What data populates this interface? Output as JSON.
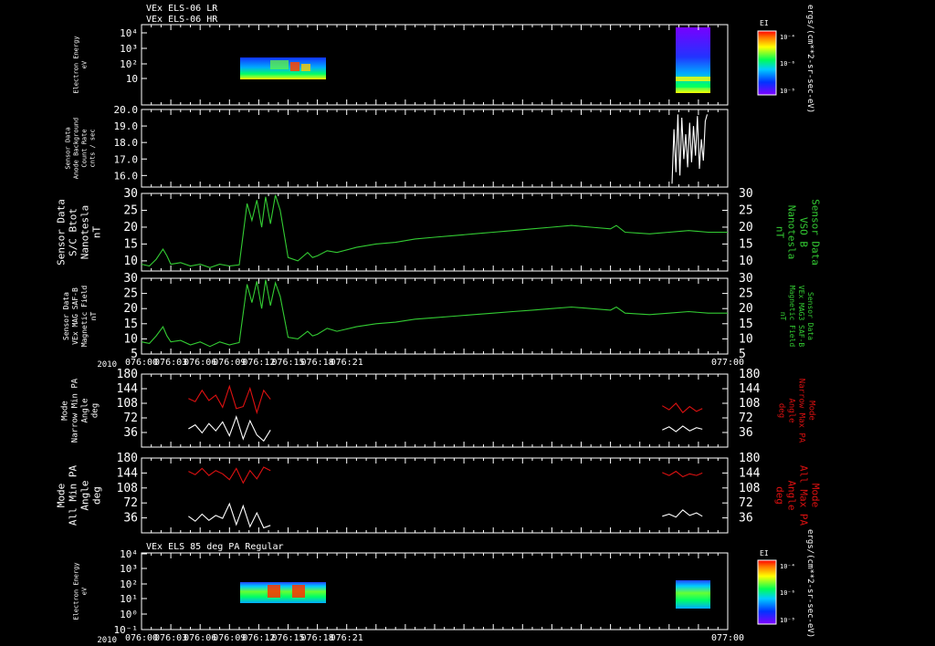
{
  "header": {
    "title_lr": "VEx ELS-06 LR",
    "title_hr": "VEx ELS-06 HR",
    "bottom_title": "VEx ELS 85 deg PA Regular",
    "year": "2010",
    "colorbar_unit": "ergs/(cm**2-sr-sec-eV)",
    "colorbar_label": "EI"
  },
  "colors": {
    "background": "#000000",
    "axis": "#ffffff",
    "mag": "#33cc33",
    "pa_max": "#dd1111",
    "pa_min": "#ffffff"
  },
  "chart_data": [
    {
      "type": "heatmap",
      "panel": "electron-energy-top",
      "ylabel": [
        "Electron Energy",
        "eV"
      ],
      "y_scale": "log",
      "yticks": [
        "10",
        "10²",
        "10³",
        "10⁴"
      ],
      "x_minutes": [
        0,
        60
      ],
      "xticks": [
        "076:00",
        "076:03",
        "076:06",
        "076:09",
        "076:12",
        "076:15",
        "076:18",
        "076:21",
        "077:00"
      ],
      "data_blocks": [
        {
          "t_start": 4.8,
          "t_end": 12.9,
          "e_min": 8,
          "e_max": 200
        },
        {
          "t_start": 53.5,
          "t_end": 57.5,
          "e_min": 4,
          "e_max": 15000
        }
      ],
      "colorbar": {
        "label": "EI",
        "ticks": [
          "10⁻⁴",
          "10⁻⁶",
          "10⁻⁸"
        ]
      }
    },
    {
      "type": "line",
      "panel": "anode-background",
      "ylabel": [
        "Sensor Data",
        "Anode Background",
        "Count Rate",
        "cnts / sec"
      ],
      "ylim": [
        15.3,
        20
      ],
      "yticks": [
        "16.0",
        "17.0",
        "18.0",
        "19.0",
        "20.0"
      ],
      "series": [
        {
          "color": "white",
          "x": [
            54.3,
            54.5,
            54.7,
            54.9,
            55.1,
            55.3,
            55.5,
            55.7,
            55.9,
            56.1,
            56.3,
            56.5,
            56.7,
            56.9,
            57.1,
            57.3,
            57.5,
            57.7,
            57.9
          ],
          "y": [
            15.5,
            18.8,
            16.2,
            19.7,
            16.0,
            19.5,
            17.0,
            18.5,
            16.5,
            19.2,
            16.8,
            19.0,
            17.2,
            19.6,
            16.4,
            18.2,
            16.9,
            19.3,
            19.7
          ]
        }
      ]
    },
    {
      "type": "line",
      "panel": "bmag-sc",
      "ylabel": [
        "Sensor Data",
        "S/C Btot",
        "Nanotesla",
        "nT"
      ],
      "ylabel_right": [
        "Sensor Data",
        "VSO B",
        "Nanotesla",
        "nT"
      ],
      "ylim": [
        7,
        30
      ],
      "yticks": [
        "10",
        "15",
        "20",
        "25",
        "30"
      ],
      "series": [
        {
          "color": "green",
          "x": [
            0,
            0.8,
            1.5,
            2.2,
            2.6,
            3.0,
            4.0,
            5.0,
            6.0,
            7.0,
            8.0,
            9.0,
            10.0,
            10.8,
            11.3,
            11.8,
            12.3,
            12.7,
            13.2,
            13.7,
            14.2,
            15.0,
            16.0,
            17.0,
            17.5,
            18.0,
            19.0,
            20.0,
            22.0,
            24.0,
            26.0,
            28.0,
            30.0,
            32.0,
            34.0,
            36.0,
            38.0,
            40.0,
            42.0,
            44.0,
            46.0,
            48.0,
            48.6,
            49.5,
            52.0,
            54.0,
            56.0,
            58.0,
            60.0
          ],
          "y": [
            9.0,
            8.5,
            10.5,
            13.5,
            11.5,
            9.0,
            9.5,
            8.5,
            9.0,
            8.0,
            9.0,
            8.5,
            8.8,
            27.0,
            22.0,
            28.0,
            20.0,
            29.0,
            21.0,
            29.5,
            25.0,
            11.0,
            10.0,
            12.5,
            11.0,
            11.5,
            13.0,
            12.5,
            14.0,
            15.0,
            15.5,
            16.5,
            17.0,
            17.5,
            18.0,
            18.5,
            19.0,
            19.5,
            20.0,
            20.5,
            20.0,
            19.5,
            20.5,
            18.5,
            18.0,
            18.5,
            19.0,
            18.5,
            18.5
          ]
        }
      ]
    },
    {
      "type": "line",
      "panel": "bmag-saf",
      "ylabel": [
        "Sensor Data",
        "VEx MAG SAF-B",
        "Magnetic Field",
        "nT"
      ],
      "ylabel_right": [
        "Sensor Data",
        "VEx MAG3 SAF-B",
        "Magnetic Field",
        "nT"
      ],
      "ylim": [
        5,
        30
      ],
      "yticks": [
        "5",
        "10",
        "15",
        "20",
        "25",
        "30"
      ],
      "series": [
        {
          "color": "green",
          "x": [
            0,
            0.8,
            1.5,
            2.2,
            2.6,
            3.0,
            4.0,
            5.0,
            6.0,
            7.0,
            8.0,
            9.0,
            10.0,
            10.8,
            11.3,
            11.8,
            12.3,
            12.7,
            13.2,
            13.7,
            14.2,
            15.0,
            16.0,
            17.0,
            17.5,
            18.0,
            19.0,
            20.0,
            22.0,
            24.0,
            26.0,
            28.0,
            30.0,
            32.0,
            34.0,
            36.0,
            38.0,
            40.0,
            42.0,
            44.0,
            46.0,
            48.0,
            48.6,
            49.5,
            52.0,
            54.0,
            56.0,
            58.0,
            60.0
          ],
          "y": [
            9.0,
            8.5,
            11.0,
            14.0,
            11.0,
            9.0,
            9.5,
            8.0,
            9.0,
            7.5,
            9.0,
            8.0,
            8.8,
            28.0,
            22.0,
            29.0,
            20.0,
            29.5,
            21.0,
            28.5,
            24.0,
            10.5,
            10.0,
            12.5,
            11.0,
            11.5,
            13.5,
            12.5,
            14.0,
            15.0,
            15.5,
            16.5,
            17.0,
            17.5,
            18.0,
            18.5,
            19.0,
            19.5,
            20.0,
            20.5,
            20.0,
            19.5,
            20.5,
            18.5,
            18.0,
            18.5,
            19.0,
            18.5,
            18.5
          ]
        }
      ]
    },
    {
      "type": "line",
      "panel": "pa-narrow",
      "ylabel": [
        "Mode",
        "Narrow Min PA",
        "Angle",
        "deg"
      ],
      "ylabel_right": [
        "Mode",
        "Narrow Max PA",
        "Angle",
        "deg"
      ],
      "ylim": [
        0,
        180
      ],
      "yticks": [
        "36",
        "72",
        "108",
        "144",
        "180"
      ],
      "series": [
        {
          "color": "red",
          "x": [
            4.8,
            5.5,
            6.2,
            6.9,
            7.6,
            8.3,
            9.0,
            9.7,
            10.4,
            11.1,
            11.8,
            12.5,
            13.2
          ],
          "y": [
            120,
            112,
            140,
            115,
            128,
            98,
            150,
            95,
            100,
            145,
            85,
            140,
            118
          ]
        },
        {
          "color": "white",
          "x": [
            4.8,
            5.5,
            6.2,
            6.9,
            7.6,
            8.3,
            9.0,
            9.7,
            10.4,
            11.1,
            11.8,
            12.5,
            13.2
          ],
          "y": [
            45,
            55,
            35,
            58,
            40,
            62,
            28,
            75,
            20,
            65,
            30,
            15,
            42
          ]
        },
        {
          "color": "red",
          "x": [
            53.3,
            54.0,
            54.7,
            55.4,
            56.1,
            56.8,
            57.4
          ],
          "y": [
            102,
            92,
            108,
            85,
            100,
            88,
            95
          ]
        },
        {
          "color": "white",
          "x": [
            53.3,
            54.0,
            54.7,
            55.4,
            56.1,
            56.8,
            57.4
          ],
          "y": [
            42,
            50,
            38,
            52,
            40,
            48,
            44
          ]
        }
      ]
    },
    {
      "type": "line",
      "panel": "pa-all",
      "ylabel": [
        "Mode",
        "All Min PA",
        "Angle",
        "deg"
      ],
      "ylabel_right": [
        "Mode",
        "All Max PA",
        "Angle",
        "deg"
      ],
      "ylim": [
        0,
        180
      ],
      "yticks": [
        "36",
        "72",
        "108",
        "144",
        "180"
      ],
      "series": [
        {
          "color": "red",
          "x": [
            4.8,
            5.5,
            6.2,
            6.9,
            7.6,
            8.3,
            9.0,
            9.7,
            10.4,
            11.1,
            11.8,
            12.5,
            13.2
          ],
          "y": [
            148,
            140,
            155,
            138,
            150,
            142,
            128,
            155,
            120,
            150,
            130,
            158,
            150
          ]
        },
        {
          "color": "white",
          "x": [
            4.8,
            5.5,
            6.2,
            6.9,
            7.6,
            8.3,
            9.0,
            9.7,
            10.4,
            11.1,
            11.8,
            12.5,
            13.2
          ],
          "y": [
            40,
            28,
            45,
            30,
            42,
            35,
            70,
            20,
            65,
            15,
            48,
            12,
            18
          ]
        },
        {
          "color": "red",
          "x": [
            53.3,
            54.0,
            54.7,
            55.4,
            56.1,
            56.8,
            57.4
          ],
          "y": [
            145,
            138,
            148,
            135,
            142,
            138,
            144
          ]
        },
        {
          "color": "white",
          "x": [
            53.3,
            54.0,
            54.7,
            55.4,
            56.1,
            56.8,
            57.4
          ],
          "y": [
            40,
            45,
            38,
            55,
            42,
            48,
            40
          ]
        }
      ]
    },
    {
      "type": "heatmap",
      "panel": "electron-energy-bottom",
      "ylabel": [
        "Electron Energy",
        "eV"
      ],
      "y_scale": "log",
      "yticks": [
        "10⁻¹",
        "10⁰",
        "10¹",
        "10²",
        "10³",
        "10⁴"
      ],
      "data_blocks": [
        {
          "t_start": 4.8,
          "t_end": 12.9,
          "e_min": 5,
          "e_max": 150
        },
        {
          "t_start": 53.5,
          "t_end": 57.5,
          "e_min": 2,
          "e_max": 100
        }
      ],
      "colorbar": {
        "label": "EI",
        "ticks": [
          "10⁻⁴",
          "10⁻⁶",
          "10⁻⁸"
        ]
      }
    }
  ]
}
